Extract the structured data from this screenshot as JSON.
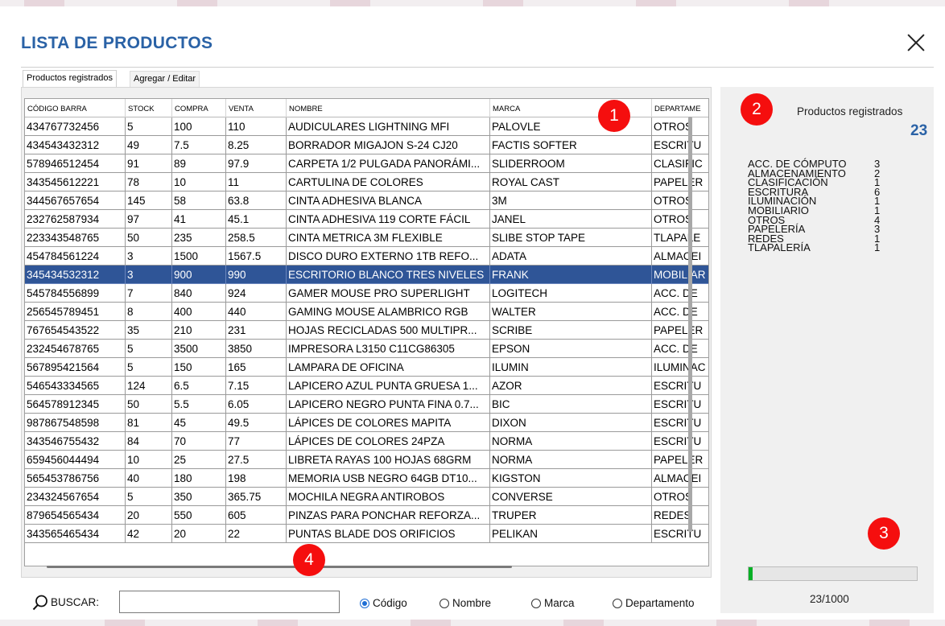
{
  "window": {
    "title": "LISTA DE PRODUCTOS",
    "close_icon": "close-icon"
  },
  "tabs": [
    {
      "label": "Productos registrados",
      "active": true
    },
    {
      "label": "Agregar / Editar",
      "active": false
    }
  ],
  "table": {
    "columns": [
      "CÓDIGO BARRA",
      "STOCK",
      "COMPRA",
      "VENTA",
      "NOMBRE",
      "MARCA",
      "DEPARTAME"
    ],
    "selected_row": 8,
    "rows": [
      [
        "434767732456",
        "5",
        "100",
        "110",
        "AUDICULARES LIGHTNING MFI",
        "PALOVLE",
        "OTROS"
      ],
      [
        "434543432312",
        "49",
        "7.5",
        "8.25",
        "BORRADOR MIGAJON S-24 CJ20",
        "FACTIS SOFTER",
        "ESCRITU"
      ],
      [
        "578946512454",
        "91",
        "89",
        "97.9",
        "CARPETA 1/2 PULGADA PANORÁMI...",
        "SLIDERROOM",
        "CLASIFIC"
      ],
      [
        "343545612221",
        "78",
        "10",
        "11",
        "CARTULINA DE COLORES",
        "ROYAL CAST",
        "PAPELER"
      ],
      [
        "344567657654",
        "145",
        "58",
        "63.8",
        "CINTA ADHESIVA BLANCA",
        "3M",
        "OTROS"
      ],
      [
        "232762587934",
        "97",
        "41",
        "45.1",
        "CINTA ADHESIVA 119 CORTE FÁCIL",
        "JANEL",
        "OTROS"
      ],
      [
        "223343548765",
        "50",
        "235",
        "258.5",
        "CINTA METRICA 3M FLEXIBLE",
        "SLIBE STOP TAPE",
        "TLAPALE"
      ],
      [
        "454784561224",
        "3",
        "1500",
        "1567.5",
        "DISCO DURO EXTERNO 1TB REFO...",
        "ADATA",
        "ALMACEI"
      ],
      [
        "345434532312",
        "3",
        "900",
        "990",
        "ESCRITORIO BLANCO TRES NIVELES",
        "FRANK",
        "MOBILIAR"
      ],
      [
        "545784556899",
        "7",
        "840",
        "924",
        "GAMER MOUSE PRO SUPERLIGHT",
        "LOGITECH",
        "ACC. DE"
      ],
      [
        "256545789451",
        "8",
        "400",
        "440",
        "GAMING MOUSE ALAMBRICO RGB",
        "WALTER",
        "ACC. DE"
      ],
      [
        "767654543522",
        "35",
        "210",
        "231",
        "HOJAS RECICLADAS 500 MULTIPR...",
        "SCRIBE",
        "PAPELER"
      ],
      [
        "232454678765",
        "5",
        "3500",
        "3850",
        "IMPRESORA L3150 C11CG86305",
        "EPSON",
        "ACC. DE"
      ],
      [
        "567895421564",
        "5",
        "150",
        "165",
        "LAMPARA DE OFICINA",
        "ILUMIN",
        "ILUMINAC"
      ],
      [
        "546543334565",
        "124",
        "6.5",
        "7.15",
        "LAPICERO AZUL PUNTA GRUESA 1...",
        "AZOR",
        "ESCRITU"
      ],
      [
        "564578912345",
        "50",
        "5.5",
        "6.05",
        "LAPICERO NEGRO PUNTA FINA 0.7...",
        "BIC",
        "ESCRITU"
      ],
      [
        "987867548598",
        "81",
        "45",
        "49.5",
        "LÁPICES DE COLORES MAPITA",
        "DIXON",
        "ESCRITU"
      ],
      [
        "343546755432",
        "84",
        "70",
        "77",
        "LÁPICES DE COLORES 24PZA",
        "NORMA",
        "ESCRITU"
      ],
      [
        "659456044494",
        "10",
        "25",
        "27.5",
        "LIBRETA RAYAS 100 HOJAS 68GRM",
        "NORMA",
        "PAPELER"
      ],
      [
        "565453786756",
        "40",
        "180",
        "198",
        "MEMORIA USB NEGRO 64GB DT10...",
        "KIGSTON",
        "ALMACEI"
      ],
      [
        "234324567654",
        "5",
        "350",
        "365.75",
        "MOCHILA NEGRA ANTIROBOS",
        "CONVERSE",
        "OTROS"
      ],
      [
        "879654565434",
        "20",
        "550",
        "605",
        "PINZAS PARA PONCHAR REFORZA...",
        "TRUPER",
        "REDES"
      ],
      [
        "343565465434",
        "42",
        "20",
        "22",
        "PUNTAS BLADE DOS ORIFICIOS",
        "PELIKAN",
        "ESCRITU"
      ]
    ]
  },
  "side_panel": {
    "title": "Productos registrados",
    "total": "23",
    "categories": [
      {
        "name": "ACC. DE CÓMPUTO",
        "count": "3"
      },
      {
        "name": "ALMACENAMIENTO",
        "count": "2"
      },
      {
        "name": "CLASIFICACIÓN",
        "count": "1"
      },
      {
        "name": "ESCRITURA",
        "count": "6"
      },
      {
        "name": "ILUMINACIÓN",
        "count": "1"
      },
      {
        "name": "MOBILIARIO",
        "count": "1"
      },
      {
        "name": "OTROS",
        "count": "4"
      },
      {
        "name": "PAPELERÍA",
        "count": "3"
      },
      {
        "name": "REDES",
        "count": "1"
      },
      {
        "name": "TLAPALERÍA",
        "count": "1"
      }
    ],
    "progress_value": 0.023,
    "progress_text": "23/1000",
    "progress_color": "#06b025"
  },
  "search": {
    "label": "BUSCAR:",
    "value": "",
    "icon": "search-icon",
    "options": [
      {
        "label": "Código",
        "checked": true
      },
      {
        "label": "Nombre",
        "checked": false
      },
      {
        "label": "Marca",
        "checked": false
      },
      {
        "label": "Departamento",
        "checked": false
      }
    ]
  },
  "markers": [
    "1",
    "2",
    "3",
    "4"
  ],
  "colors": {
    "title": "#2a62a6",
    "selected_row": "#2f5597",
    "marker": "#f50e0e"
  }
}
